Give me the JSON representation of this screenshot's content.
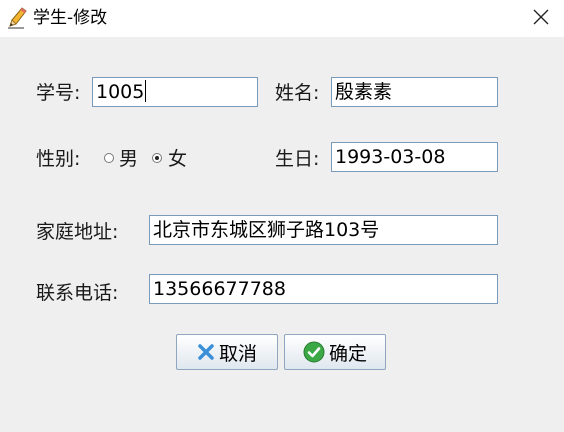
{
  "window": {
    "title": "学生-修改",
    "icons": {
      "title": "pencil-icon",
      "close": "close-icon"
    }
  },
  "form": {
    "student_id": {
      "label": "学号:",
      "value": "1005"
    },
    "name": {
      "label": "姓名:",
      "value": "殷素素"
    },
    "gender": {
      "label": "性别:",
      "options": [
        "男",
        "女"
      ],
      "selected": "女"
    },
    "birthday": {
      "label": "生日:",
      "value": "1993-03-08"
    },
    "address": {
      "label": "家庭地址:",
      "value": "北京市东城区狮子路103号"
    },
    "phone": {
      "label": "联系电话:",
      "value": "13566677788"
    }
  },
  "buttons": {
    "cancel": {
      "label": "取消",
      "icon": "x-icon",
      "color": "#3b8fd8"
    },
    "confirm": {
      "label": "确定",
      "icon": "check-circle-icon",
      "color": "#3aa845"
    }
  }
}
